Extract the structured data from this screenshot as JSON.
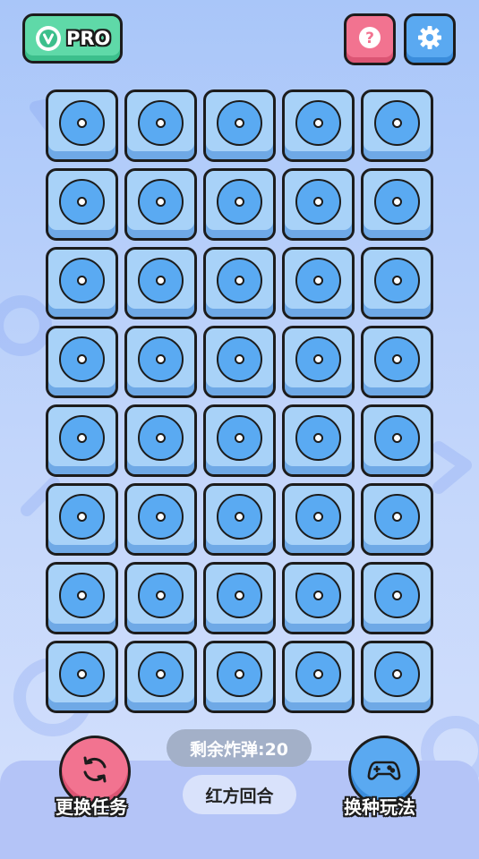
{
  "header": {
    "pro_label": "PRO",
    "pro_icon": "v-badge-icon",
    "help_icon": "question-icon",
    "settings_icon": "gear-icon"
  },
  "board": {
    "rows": 8,
    "columns": 5,
    "tile_icon": "disc-icon"
  },
  "status": {
    "bombs_remaining": "剩余炸弹:20",
    "turn": "红方回合"
  },
  "actions": {
    "swap_task_label": "更换任务",
    "swap_task_icon": "refresh-icon",
    "change_mode_label": "换种玩法",
    "change_mode_icon": "gamepad-icon"
  },
  "colors": {
    "background": "#a9c6f9",
    "tile": "#a8d2f8",
    "disc": "#5aaaf2",
    "pro_green": "#5fd9a8",
    "help_pink": "#f27390",
    "settings_blue": "#5aa9f1"
  }
}
